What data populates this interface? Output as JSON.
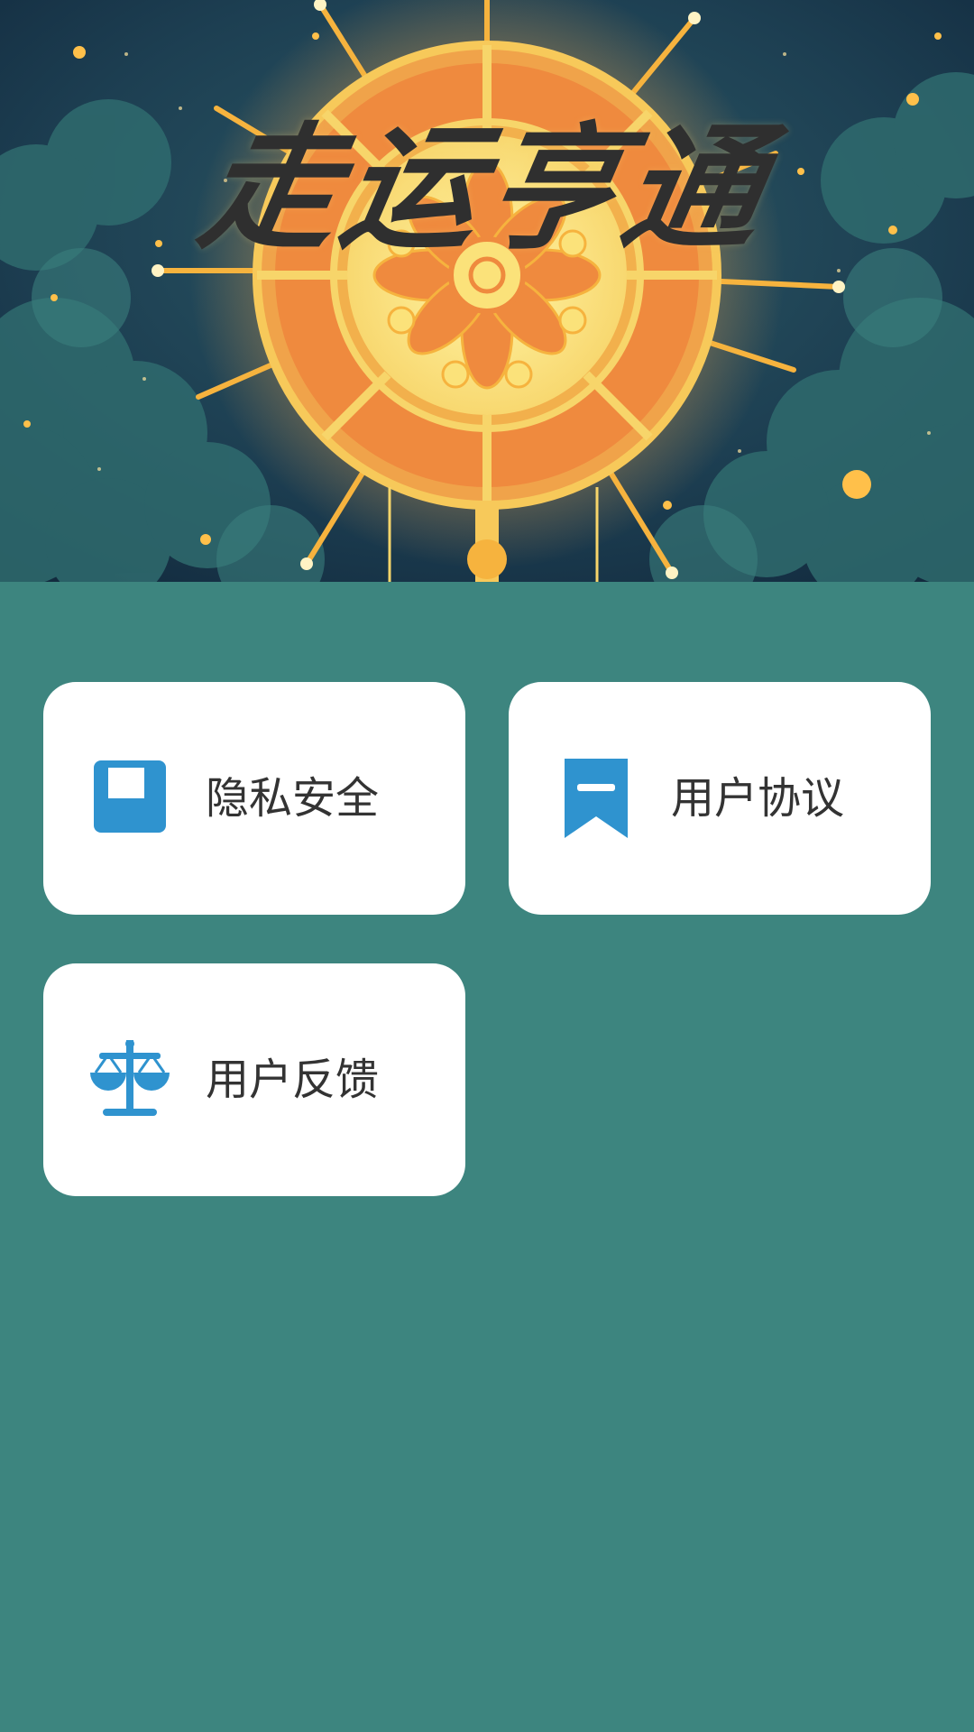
{
  "app_title": "走运亨通",
  "menu": {
    "privacy": {
      "label": "隐私安全",
      "icon": "privacy-square-icon"
    },
    "agreement": {
      "label": "用户协议",
      "icon": "bookmark-icon"
    },
    "feedback": {
      "label": "用户反馈",
      "icon": "scale-icon"
    }
  },
  "colors": {
    "background": "#3d857f",
    "card": "#ffffff",
    "icon": "#2f93cf",
    "text": "#333333"
  }
}
